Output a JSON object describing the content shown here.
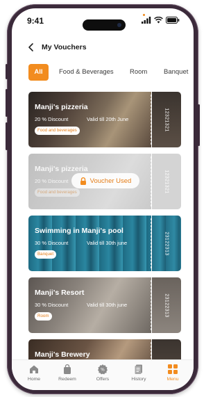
{
  "status_bar": {
    "time": "9:41"
  },
  "header": {
    "title": "My Vouchers"
  },
  "tabs": [
    {
      "label": "All",
      "active": true
    },
    {
      "label": "Food & Beverages",
      "active": false
    },
    {
      "label": "Room",
      "active": false
    },
    {
      "label": "Banquet",
      "active": false
    }
  ],
  "vouchers": [
    {
      "name": "Manji's pizzeria",
      "discount": "20 % Discount",
      "validity": "Valid till 20th June",
      "category": "Food and beverages",
      "code": "12321321",
      "used": false
    },
    {
      "name": "Manji's pizzeria",
      "discount": "20 % Discount",
      "validity": "",
      "category": "Food and beverages",
      "code": "12321321",
      "used": true,
      "used_label": "Voucher Used"
    },
    {
      "name": "Swimming in Manji's pool",
      "discount": "30 % Discount",
      "validity": "Valid till 30th june",
      "category": "Banquet",
      "code": "23122313",
      "used": false
    },
    {
      "name": "Manji's Resort",
      "discount": "30 % Discount",
      "validity": "Valid till 30th june",
      "category": "Room",
      "code": "23122313",
      "used": false
    },
    {
      "name": "Manji's Brewery",
      "discount": "",
      "validity": "",
      "category": "",
      "code": "",
      "used": false
    }
  ],
  "bottom_nav": [
    {
      "label": "Home",
      "icon": "home-icon",
      "active": false
    },
    {
      "label": "Redeem",
      "icon": "bag-icon",
      "active": false
    },
    {
      "label": "Offers",
      "icon": "offer-badge-icon",
      "active": false
    },
    {
      "label": "History",
      "icon": "history-icon",
      "active": false
    },
    {
      "label": "Menu",
      "icon": "grid-menu-icon",
      "active": true
    }
  ],
  "colors": {
    "accent": "#f28c1f",
    "badge_text": "#e47d18",
    "frame": "#3b2a3a"
  }
}
